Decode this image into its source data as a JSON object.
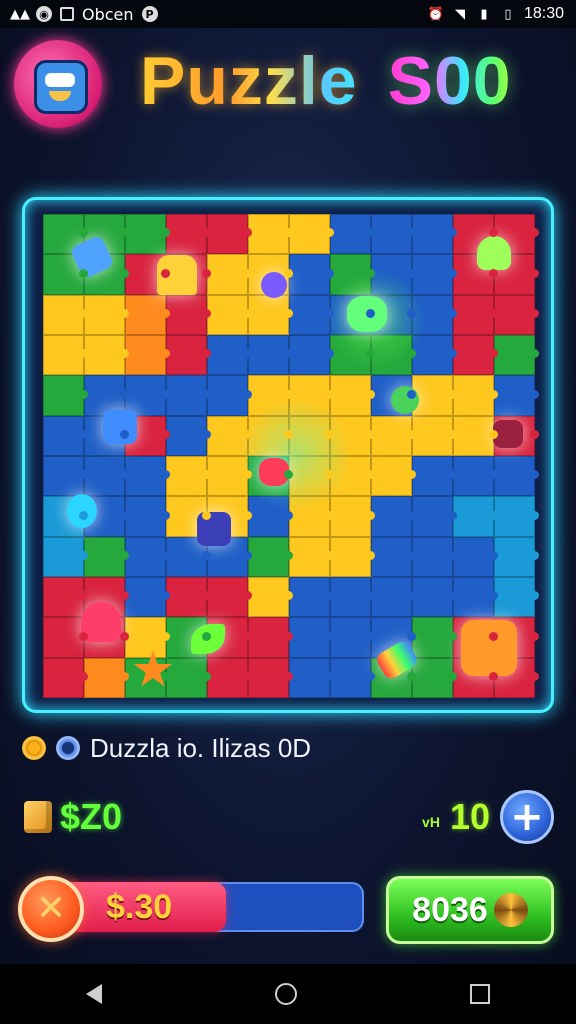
{
  "status_bar": {
    "app_label": "Obcen",
    "time": "18:30",
    "left_icons": [
      "notification-icon",
      "camera-icon",
      "image-icon",
      "p-circle-icon"
    ],
    "right_icons": [
      "alarm-icon",
      "wifi-icon",
      "signal-icon",
      "battery-icon"
    ]
  },
  "header": {
    "title_word1": "Puzzle",
    "title_word2": "S00",
    "avatar_icon": "monster-avatar-icon"
  },
  "board": {
    "rows": 12,
    "cols": 12,
    "palette": {
      "b": "#1f5fc7",
      "r": "#d9233f",
      "y": "#ffc81e",
      "g": "#25a83c",
      "o": "#ff8a1e",
      "c": "#1a9ad6"
    }
  },
  "info_row": {
    "text": "Duzzla io. Ilizas 0D"
  },
  "currency": {
    "cash": "$Z0",
    "lives_prefix": "vH",
    "lives": "10",
    "plus_label": "+"
  },
  "progress": {
    "label": "$.30",
    "fill_fraction": 0.55,
    "close_label": "✕"
  },
  "score_button": {
    "value": "8036"
  },
  "colors": {
    "board_border": "#47f0ff",
    "cash_green": "#63ff3a",
    "progress_red": "#e11e4b",
    "score_green": "#2fc021"
  }
}
